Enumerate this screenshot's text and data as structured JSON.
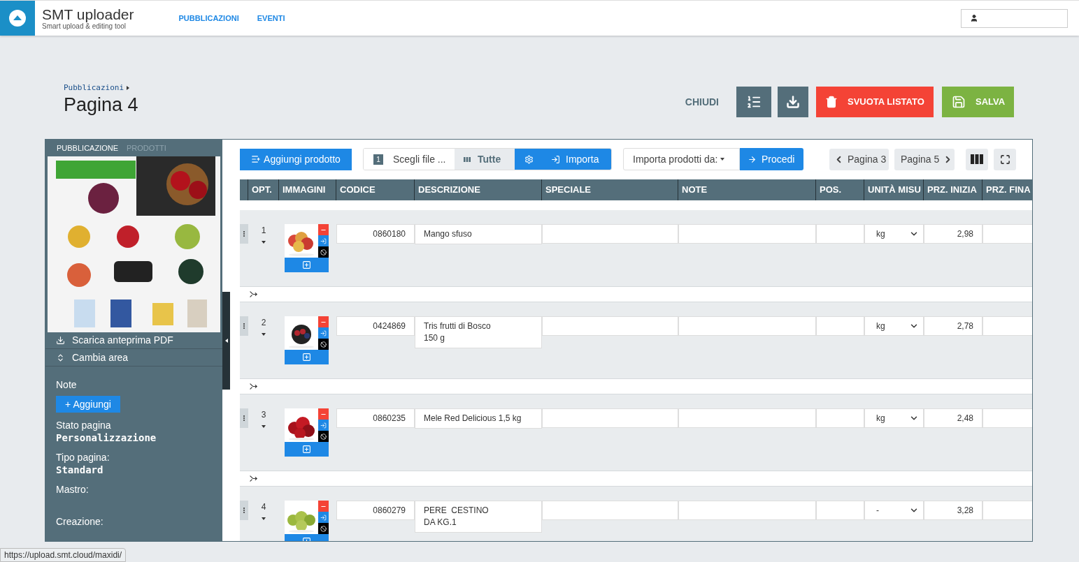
{
  "header": {
    "app_title": "SMT uploader",
    "app_subtitle": "Smart upload & editing tool",
    "nav": [
      {
        "label": "PUBBLICAZIONI"
      },
      {
        "label": "EVENTI"
      }
    ]
  },
  "breadcrumb": "Pubblicazioni",
  "page_title": "Pagina 4",
  "actions": {
    "close": "CHIUDI",
    "clear": "SVUOTA LISTATO",
    "save": "SALVA"
  },
  "sidebar": {
    "tabs": [
      {
        "label": "PUBBLICAZIONE",
        "selected": true
      },
      {
        "label": "PRODOTTI",
        "selected": false
      }
    ],
    "preview": {
      "kind": "picture"
    },
    "menu": [
      {
        "label": "Scarica anteprima PDF",
        "kind": "download"
      },
      {
        "label": "Cambia area",
        "kind": "area"
      }
    ],
    "note_label": "Note",
    "add_note": "+ Aggiungi",
    "fields": [
      {
        "label": "Stato pagina",
        "value": "Personalizzazione"
      },
      {
        "label": "Tipo pagina:",
        "value": "Standard"
      },
      {
        "label": "Mastro:"
      },
      {
        "label": "Creazione:"
      }
    ]
  },
  "toolbar": {
    "add_product": "Aggiungi prodotto",
    "file_step": "1",
    "file_placeholder": "Scegli file ...",
    "filter": "Tutte",
    "import": "Importa",
    "import_from": "Importa prodotti da:",
    "proceed": "Procedi",
    "prev_page": "Pagina 3",
    "next_page": "Pagina 5"
  },
  "table": {
    "columns": [
      "OPT.",
      "IMMAGINI",
      "CODICE",
      "DESCRIZIONE",
      "SPECIALE",
      "NOTE",
      "POS.",
      "UNITÀ MISU",
      "PRZ. INIZIA",
      "PRZ. FINA"
    ],
    "rows": [
      {
        "opt": "1",
        "image": {
          "kind": "picture"
        },
        "code": "0860180",
        "description": [
          "Mango sfuso"
        ],
        "unit": "kg",
        "price": "2,98"
      },
      {
        "opt": "2",
        "image": {
          "kind": "picture"
        },
        "code": "0424869",
        "description": [
          "Tris frutti di Bosco",
          "150 g"
        ],
        "unit": "kg",
        "price": "2,78"
      },
      {
        "opt": "3",
        "image": {
          "kind": "picture"
        },
        "code": "0860235",
        "description": [
          "Mele Red Delicious 1,5 kg"
        ],
        "unit": "kg",
        "price": "2,48"
      },
      {
        "opt": "4",
        "image": {
          "kind": "picture"
        },
        "code": "0860279",
        "description": [
          "PERE  CESTINO",
          "DA KG.1"
        ],
        "unit": "-",
        "price": "3,28"
      }
    ]
  },
  "status_url": "https://upload.smt.cloud/maxidi/"
}
